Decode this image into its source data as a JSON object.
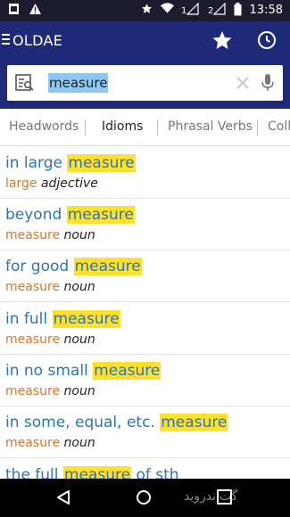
{
  "status_bar": {
    "time": "13:58",
    "left_icons": [
      "app-notification-icon",
      "warning-icon"
    ],
    "right_icons": [
      "star-icon",
      "wifi-icon",
      "sim-1-signal-icon",
      "sim-2-signal-icon",
      "battery-icon"
    ],
    "sim1_label": "1",
    "sim2_label": "2"
  },
  "app_bar": {
    "title": "OLDAE",
    "actions": [
      "favorites-star-icon",
      "history-clock-icon"
    ]
  },
  "search": {
    "value": "measure",
    "lead_icon": "search-list-icon",
    "clear_icon": "clear-icon",
    "mic_icon": "microphone-icon"
  },
  "tabs": [
    {
      "label": "Headwords",
      "active": false
    },
    {
      "label": "Idioms",
      "active": true
    },
    {
      "label": "Phrasal Verbs",
      "active": false
    },
    {
      "label": "Coll",
      "active": false
    }
  ],
  "results": [
    {
      "before": "in large ",
      "highlight": "measure",
      "after": "",
      "headword": "large",
      "pos": "adjective"
    },
    {
      "before": "beyond ",
      "highlight": "measure",
      "after": "",
      "headword": "measure",
      "pos": "noun"
    },
    {
      "before": "for good ",
      "highlight": "measure",
      "after": "",
      "headword": "measure",
      "pos": "noun"
    },
    {
      "before": "in full ",
      "highlight": "measure",
      "after": "",
      "headword": "measure",
      "pos": "noun"
    },
    {
      "before": "in no small ",
      "highlight": "measure",
      "after": "",
      "headword": "measure",
      "pos": "noun"
    },
    {
      "before": "in some, equal, etc. ",
      "highlight": "measure",
      "after": "",
      "headword": "measure",
      "pos": "noun"
    },
    {
      "before": "the full ",
      "highlight": "measure",
      "after": " of sth",
      "headword": "",
      "pos": ""
    }
  ],
  "nav_bar": {
    "buttons": [
      "back-icon",
      "home-icon",
      "recents-icon"
    ],
    "watermark": "گت‌اندروید"
  },
  "colors": {
    "status_bar": "#1c1c2e",
    "app_bar": "#1e2a78",
    "phrase_text": "#2e74b5",
    "highlight": "#ffe12b",
    "headword_text": "#d9752d",
    "search_selection": "#8ec8f2"
  }
}
